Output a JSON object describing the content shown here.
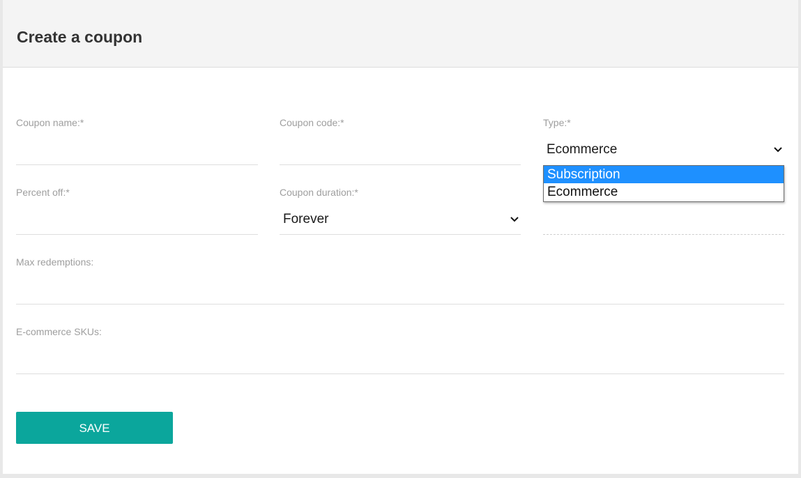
{
  "header": {
    "title": "Create a coupon"
  },
  "form": {
    "coupon_name": {
      "label": "Coupon name:*",
      "value": ""
    },
    "coupon_code": {
      "label": "Coupon code:*",
      "value": ""
    },
    "type": {
      "label": "Type:*",
      "value": "Ecommerce",
      "options": [
        "Subscription",
        "Ecommerce"
      ],
      "highlighted": "Subscription"
    },
    "percent_off": {
      "label": "Percent off:*",
      "value": ""
    },
    "coupon_duration": {
      "label": "Coupon duration:*",
      "value": "Forever"
    },
    "max_redemptions": {
      "label": "Max redemptions:",
      "value": ""
    },
    "ecommerce_skus": {
      "label": "E-commerce SKUs:",
      "value": ""
    }
  },
  "actions": {
    "save_label": "SAVE"
  },
  "colors": {
    "accent": "#0ba69c",
    "highlight": "#1e90ff"
  }
}
